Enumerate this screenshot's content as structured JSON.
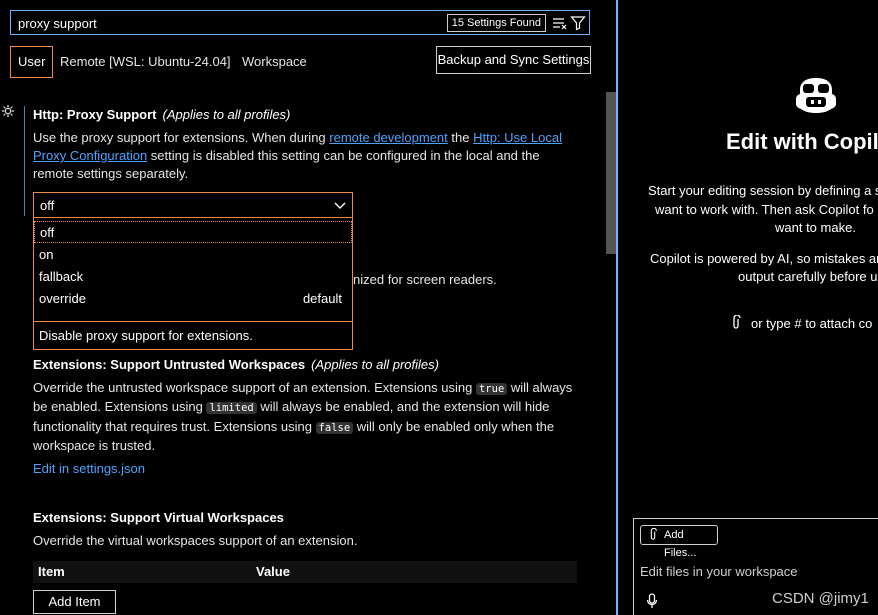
{
  "search": {
    "value": "proxy support",
    "found_badge": "15 Settings Found"
  },
  "tabs": [
    {
      "label": "User",
      "active": true
    },
    {
      "label": "Remote [WSL: Ubuntu-24.04]",
      "active": false
    },
    {
      "label": "Workspace",
      "active": false
    }
  ],
  "sync_button": "Backup and Sync Settings",
  "settings": {
    "proxy_support": {
      "title": "Http: Proxy Support",
      "scope": "(Applies to all profiles)",
      "desc_1": "Use the proxy support for extensions. When during ",
      "link_1": "remote development",
      "desc_2": " the ",
      "link_2": "Http: Use Local Proxy Configuration",
      "desc_3": " setting is disabled this setting can be configured in the local and the remote settings separately.",
      "selected": "off",
      "options": [
        {
          "label": "off",
          "tag": ""
        },
        {
          "label": "on",
          "tag": ""
        },
        {
          "label": "fallback",
          "tag": ""
        },
        {
          "label": "override",
          "tag": "default"
        }
      ],
      "option_description": "Disable proxy support for extensions.",
      "obscured_text": "nized for screen readers."
    },
    "untrusted": {
      "title": "Extensions: Support Untrusted Workspaces",
      "scope": "(Applies to all profiles)",
      "d1": "Override the untrusted workspace support of an extension. Extensions using ",
      "c1": "true",
      "d2": " will always be enabled. Extensions using ",
      "c2": "limited",
      "d3": " will always be enabled, and the extension will hide functionality that requires trust. Extensions using ",
      "c3": "false",
      "d4": " will only be enabled only when the workspace is trusted.",
      "edit_link": "Edit in settings.json"
    },
    "virtual": {
      "title": "Extensions: Support Virtual Workspaces",
      "desc": "Override the virtual workspaces support of an extension.",
      "col_item": "Item",
      "col_value": "Value",
      "add_button": "Add Item"
    }
  },
  "copilot": {
    "title": "Edit with Copilo",
    "p1_l1": "Start your editing session by defining a s",
    "p1_l2": "want to work with. Then ask Copilot fo",
    "p1_l3": "want to make.",
    "p2_l1": "Copilot is powered by AI, so mistakes ar",
    "p2_l2": "output carefully before u",
    "attach_hint": "or type # to attach co",
    "add_files": "Add Files...",
    "placeholder": "Edit files in your workspace"
  },
  "watermark": "CSDN @jimy1",
  "colors": {
    "focus_border": "#f08a4b",
    "link": "#4ea3ff",
    "search_border": "#6fb3ff"
  }
}
